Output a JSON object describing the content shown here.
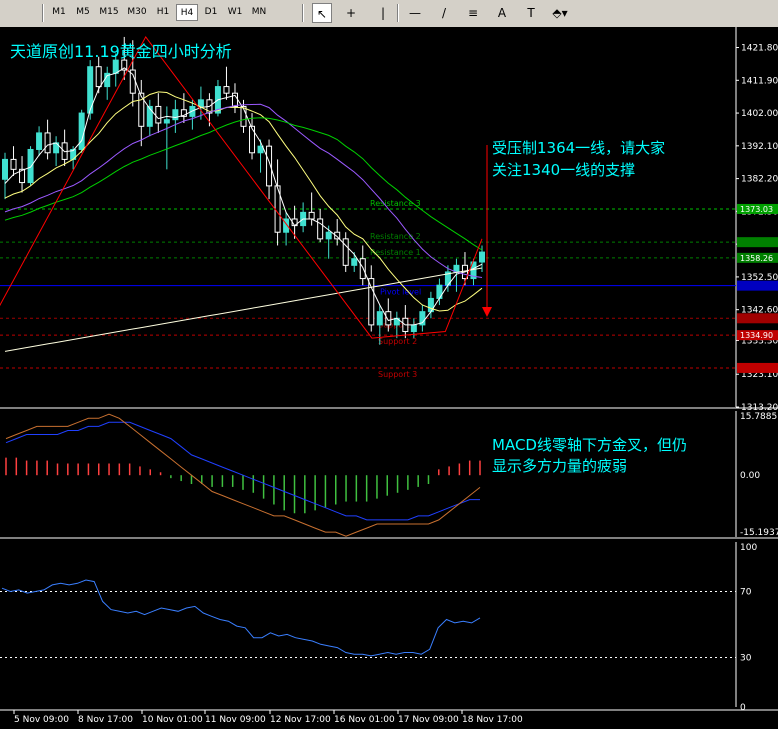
{
  "toolbar": {
    "timeframes": [
      "M1",
      "M5",
      "M15",
      "M30",
      "H1",
      "H4",
      "D1",
      "W1",
      "MN"
    ],
    "active_timeframe": "H4",
    "tools": [
      {
        "icon": "cursor-icon",
        "glyph": "↖",
        "active": true
      },
      {
        "icon": "crosshair-icon",
        "glyph": "+",
        "active": false
      },
      {
        "icon": "vertical-line-icon",
        "glyph": "|",
        "active": false
      },
      {
        "icon": "horizontal-line-icon",
        "glyph": "—",
        "active": false
      },
      {
        "icon": "trendline-icon",
        "glyph": "/",
        "active": false
      },
      {
        "icon": "fibonacci-icon",
        "glyph": "≡",
        "active": false
      },
      {
        "icon": "text-icon",
        "glyph": "A",
        "active": false
      },
      {
        "icon": "text-label-icon",
        "glyph": "T",
        "active": false
      },
      {
        "icon": "shapes-dropdown-icon",
        "glyph": "⬘▾",
        "active": false
      }
    ]
  },
  "annotations": {
    "title": "天道原创11.19黄金四小时分析",
    "price_note_line1": "受压制1364一线，请大家",
    "price_note_line2": "关注1340一线的支撑",
    "macd_note_line1": "MACD线零轴下方金叉，但仍",
    "macd_note_line2": "显示多方力量的疲弱"
  },
  "colors": {
    "background": "#000000",
    "up_candle": "#40e0d0",
    "down_candle": "#ffffff",
    "annotation_text": "#00ffff",
    "pivot_line": "#0000ff",
    "resistance": "#00c000",
    "support": "#c00000",
    "ma_fast": "#ffffff",
    "ma_mid": "#ffff80",
    "ma_slow": "#9b59ff",
    "ma_slower": "#00d000",
    "ma_slowest": "#ffffe0",
    "macd_up": "#ff4040",
    "macd_down": "#40c040",
    "rsi": "#3a7fff"
  },
  "chart_data": [
    {
      "type": "candlestick",
      "name": "price",
      "ylim": [
        1313.2,
        1428.0
      ],
      "y_ticks": [
        "1421.80",
        "1411.90",
        "1402.00",
        "1392.10",
        "1382.20",
        "1372.30",
        "1362.40",
        "1352.50",
        "1342.60",
        "1333.30",
        "1323.10",
        "1313.20"
      ],
      "candles": [
        [
          1382,
          1390,
          1376,
          1388
        ],
        [
          1388,
          1392,
          1383,
          1385
        ],
        [
          1385,
          1389,
          1378,
          1381
        ],
        [
          1381,
          1392,
          1380,
          1391
        ],
        [
          1391,
          1398,
          1389,
          1396
        ],
        [
          1396,
          1400,
          1388,
          1390
        ],
        [
          1390,
          1395,
          1386,
          1393
        ],
        [
          1393,
          1397,
          1386,
          1388
        ],
        [
          1388,
          1392,
          1385,
          1391
        ],
        [
          1391,
          1403,
          1390,
          1402
        ],
        [
          1402,
          1418,
          1400,
          1416
        ],
        [
          1416,
          1419,
          1408,
          1410
        ],
        [
          1410,
          1416,
          1406,
          1414
        ],
        [
          1414,
          1420,
          1410,
          1418
        ],
        [
          1418,
          1425,
          1412,
          1415
        ],
        [
          1415,
          1424,
          1404,
          1408
        ],
        [
          1408,
          1412,
          1392,
          1398
        ],
        [
          1398,
          1406,
          1395,
          1404
        ],
        [
          1404,
          1408,
          1396,
          1399
        ],
        [
          1399,
          1404,
          1385,
          1400
        ],
        [
          1400,
          1406,
          1396,
          1403
        ],
        [
          1403,
          1408,
          1399,
          1401
        ],
        [
          1401,
          1406,
          1397,
          1404
        ],
        [
          1404,
          1410,
          1400,
          1406
        ],
        [
          1406,
          1408,
          1398,
          1402
        ],
        [
          1402,
          1412,
          1401,
          1410
        ],
        [
          1410,
          1416,
          1406,
          1408
        ],
        [
          1408,
          1411,
          1402,
          1404
        ],
        [
          1404,
          1406,
          1396,
          1398
        ],
        [
          1398,
          1402,
          1388,
          1390
        ],
        [
          1390,
          1394,
          1384,
          1392
        ],
        [
          1392,
          1394,
          1376,
          1380
        ],
        [
          1380,
          1388,
          1362,
          1366
        ],
        [
          1366,
          1372,
          1362,
          1370
        ],
        [
          1370,
          1374,
          1364,
          1368
        ],
        [
          1368,
          1375,
          1366,
          1372
        ],
        [
          1372,
          1378,
          1368,
          1370
        ],
        [
          1370,
          1373,
          1363,
          1364
        ],
        [
          1364,
          1368,
          1358,
          1366
        ],
        [
          1366,
          1370,
          1362,
          1364
        ],
        [
          1364,
          1366,
          1354,
          1356
        ],
        [
          1356,
          1360,
          1354,
          1358
        ],
        [
          1358,
          1362,
          1350,
          1352
        ],
        [
          1352,
          1356,
          1336,
          1338
        ],
        [
          1338,
          1344,
          1332,
          1342
        ],
        [
          1342,
          1346,
          1336,
          1338
        ],
        [
          1338,
          1342,
          1334,
          1340
        ],
        [
          1340,
          1344,
          1334,
          1336
        ],
        [
          1336,
          1340,
          1334,
          1338
        ],
        [
          1338,
          1344,
          1336,
          1342
        ],
        [
          1342,
          1348,
          1340,
          1346
        ],
        [
          1346,
          1352,
          1344,
          1350
        ],
        [
          1350,
          1356,
          1348,
          1354
        ],
        [
          1354,
          1358,
          1348,
          1356
        ],
        [
          1356,
          1360,
          1350,
          1352
        ],
        [
          1352,
          1358,
          1350,
          1357
        ],
        [
          1357,
          1362,
          1354,
          1360
        ]
      ],
      "levels": [
        {
          "name": "Resistance 3",
          "value": 1373.03,
          "color": "#00c000",
          "label_bg": "#00a000"
        },
        {
          "name": "Resistance 2",
          "value": 1363.0,
          "color": "#008000",
          "label_bg": "#008000"
        },
        {
          "name": "Resistance 1",
          "value": 1358.26,
          "color": "#008000",
          "label_bg": "#008000"
        },
        {
          "name": "Pivot level",
          "value": 1349.86,
          "color": "#0000ff",
          "label_bg": "#0000c0"
        },
        {
          "name": "Support 1",
          "value": 1340.0,
          "color": "#a00000",
          "label_bg": "#a00000"
        },
        {
          "name": "Support 2",
          "value": 1334.9,
          "color": "#c00000",
          "label_bg": "#c00000"
        },
        {
          "name": "Support 3",
          "value": 1325.0,
          "color": "#c00000",
          "label_bg": "#c00000"
        }
      ],
      "level_label_texts": {
        "Resistance 3": "1373.03",
        "Resistance 1": "1358.26",
        "Support 2": "1334.90"
      },
      "zigzag": [
        [
          -0.02,
          1340
        ],
        [
          0.23,
          1425
        ],
        [
          0.6,
          1334
        ],
        [
          0.72,
          1336
        ],
        [
          0.78,
          1364
        ]
      ]
    },
    {
      "type": "bar",
      "name": "MACD",
      "ylim": [
        -15.1937,
        15.7885
      ],
      "y_ticks": [
        "15.7885",
        "0.00",
        "-15.1937"
      ],
      "hist": [
        6,
        6,
        5,
        5,
        5,
        4,
        4,
        4,
        4,
        4,
        4,
        4,
        4,
        3,
        2,
        1,
        -1,
        -2,
        -3,
        -3,
        -4,
        -4,
        -4,
        -5,
        -6,
        -8,
        -10,
        -12,
        -13,
        -13,
        -12,
        -11,
        -10,
        -9,
        -9,
        -9,
        -8,
        -7,
        -6,
        -5,
        -4,
        -3,
        2,
        3,
        4,
        5,
        5
      ]
    },
    {
      "type": "line",
      "name": "RSI",
      "ylim": [
        0,
        100
      ],
      "y_ticks": [
        "100",
        "70",
        "30",
        "0"
      ],
      "levels": [
        70,
        30
      ],
      "values": [
        72,
        70,
        71,
        69,
        70,
        71,
        74,
        75,
        74,
        75,
        77,
        76,
        64,
        59,
        58,
        57,
        58,
        56,
        58,
        60,
        59,
        58,
        60,
        61,
        57,
        55,
        53,
        52,
        49,
        48,
        42,
        42,
        45,
        43,
        44,
        42,
        41,
        40,
        38,
        37,
        36,
        33,
        32,
        32,
        31,
        32,
        33,
        32,
        33,
        33,
        32,
        35,
        48,
        53,
        51,
        52,
        51,
        54
      ]
    }
  ],
  "x_axis_labels": [
    "5 Nov 09:00",
    "8 Nov 17:00",
    "10 Nov 01:00",
    "11 Nov 09:00",
    "12 Nov 17:00",
    "16 Nov 01:00",
    "17 Nov 09:00",
    "18 Nov 17:00"
  ]
}
